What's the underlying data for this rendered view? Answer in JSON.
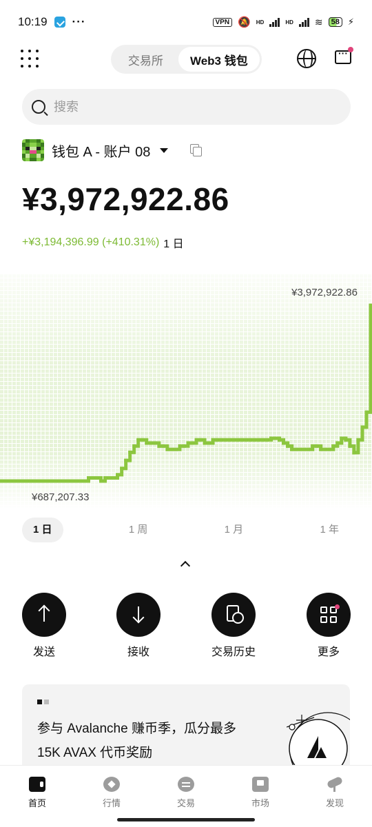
{
  "status_bar": {
    "time": "10:19",
    "more": "···",
    "vpn": "VPN",
    "hd1": "HD",
    "hd2": "HD",
    "battery": "58"
  },
  "header": {
    "tabs": [
      {
        "label": "交易所",
        "active": false
      },
      {
        "label": "Web3 钱包",
        "active": true
      }
    ],
    "icons": [
      "apps-grid-icon",
      "globe-icon",
      "chat-icon"
    ]
  },
  "search": {
    "placeholder": "搜索"
  },
  "account": {
    "name": "钱包 A - 账户 08"
  },
  "balance": {
    "total": "¥3,972,922.86",
    "change": "+¥3,194,396.99 (+410.31%)",
    "period": "1 日"
  },
  "chart_data": {
    "type": "line",
    "x": [
      0,
      1,
      2,
      3,
      4,
      5,
      6,
      7,
      8,
      9,
      10,
      11,
      12,
      13,
      14,
      15,
      16,
      17,
      18,
      19,
      20,
      21,
      22,
      23,
      24,
      25,
      26,
      27,
      28,
      29,
      30,
      31,
      32,
      33,
      34,
      35,
      36,
      37,
      38,
      39,
      40,
      41,
      42,
      43,
      44,
      45,
      46,
      47,
      48,
      49,
      50,
      51,
      52,
      53,
      54,
      55,
      56,
      57,
      58,
      59,
      60,
      61,
      62,
      63,
      64,
      65,
      66,
      67,
      68,
      69,
      70,
      71,
      72,
      73,
      74,
      75,
      76,
      77,
      78,
      79,
      80,
      81,
      82,
      83,
      84,
      85,
      86,
      87,
      88,
      89
    ],
    "series": [
      {
        "values": [
          687207,
          687207,
          687207,
          687207,
          687207,
          687207,
          687207,
          687207,
          687207,
          687207,
          687207,
          687207,
          687207,
          687207,
          687207,
          687207,
          687207,
          687207,
          687207,
          687207,
          687207,
          713000,
          713000,
          713000,
          687207,
          713000,
          713000,
          713000,
          740000,
          792000,
          860000,
          927000,
          980000,
          1032000,
          1032000,
          1005000,
          1005000,
          1005000,
          980000,
          980000,
          952000,
          952000,
          952000,
          980000,
          980000,
          1005000,
          1005000,
          1032000,
          1032000,
          1005000,
          1005000,
          1032000,
          1032000,
          1032000,
          1032000,
          1032000,
          1032000,
          1032000,
          1032000,
          1032000,
          1032000,
          1032000,
          1032000,
          1032000,
          1032000,
          1045000,
          1045000,
          1032000,
          1005000,
          980000,
          952000,
          952000,
          952000,
          952000,
          952000,
          980000,
          980000,
          952000,
          952000,
          952000,
          980000,
          1005000,
          1045000,
          1032000,
          980000,
          925000,
          1032000,
          1290000,
          1620000,
          3972922
        ]
      }
    ],
    "high_label": "¥3,972,922.86",
    "low_label": "¥687,207.33",
    "series_color": "#8cc63f"
  },
  "range_tabs": [
    {
      "label": "1 日",
      "active": true
    },
    {
      "label": "1 周",
      "active": false
    },
    {
      "label": "1 月",
      "active": false
    },
    {
      "label": "1 年",
      "active": false
    }
  ],
  "actions": [
    {
      "label": "发送",
      "icon": "arrow-up-icon"
    },
    {
      "label": "接收",
      "icon": "arrow-down-icon"
    },
    {
      "label": "交易历史",
      "icon": "history-icon"
    },
    {
      "label": "更多",
      "icon": "grid-icon"
    }
  ],
  "banner": {
    "line1": "参与 Avalanche 赚币季，瓜分最多",
    "line2": "15K AVAX 代币奖励"
  },
  "bottom_nav": [
    {
      "label": "首页",
      "icon": "wallet-icon",
      "active": true
    },
    {
      "label": "行情",
      "icon": "market-icon",
      "active": false
    },
    {
      "label": "交易",
      "icon": "trade-icon",
      "active": false
    },
    {
      "label": "市场",
      "icon": "store-icon",
      "active": false
    },
    {
      "label": "发现",
      "icon": "discover-icon",
      "active": false
    }
  ],
  "colors": {
    "accent_green": "#7dba34",
    "chart_green": "#8cc63f",
    "notification_pink": "#e0457b"
  }
}
